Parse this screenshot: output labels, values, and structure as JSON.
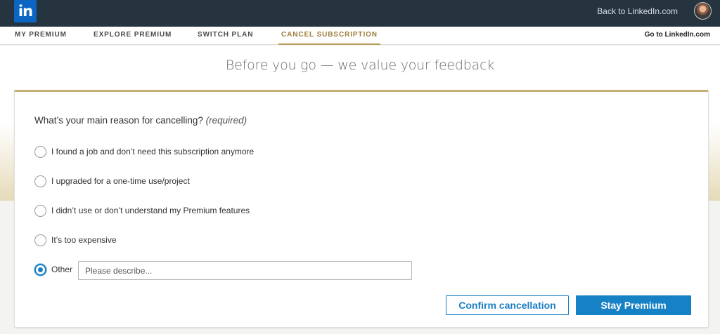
{
  "header": {
    "logo_text": "in",
    "back_link": "Back to LinkedIn.com"
  },
  "subnav": {
    "tabs": [
      {
        "label": "MY PREMIUM",
        "active": false
      },
      {
        "label": "EXPLORE PREMIUM",
        "active": false
      },
      {
        "label": "SWITCH PLAN",
        "active": false
      },
      {
        "label": "CANCEL SUBSCRIPTION",
        "active": true
      }
    ],
    "goto_link": "Go to LinkedIn.com"
  },
  "page": {
    "title": "Before you go — we value your feedback"
  },
  "form": {
    "question": "What’s your main reason for cancelling?",
    "required_note": "(required)",
    "options": [
      {
        "label": "I found a job and don’t need this subscription anymore",
        "selected": false
      },
      {
        "label": "I upgraded for a one-time use/project",
        "selected": false
      },
      {
        "label": "I didn’t use or don’t understand my Premium features",
        "selected": false
      },
      {
        "label": "It’s too expensive",
        "selected": false
      },
      {
        "label": "Other",
        "selected": true
      }
    ],
    "other_input": {
      "value": "",
      "placeholder": "Please describe..."
    },
    "confirm_label": "Confirm cancellation",
    "stay_label": "Stay Premium"
  },
  "colors": {
    "topbar": "#263440",
    "brand_blue": "#0a66c2",
    "accent_gold": "#b59a56",
    "primary_button": "#1681c4"
  }
}
